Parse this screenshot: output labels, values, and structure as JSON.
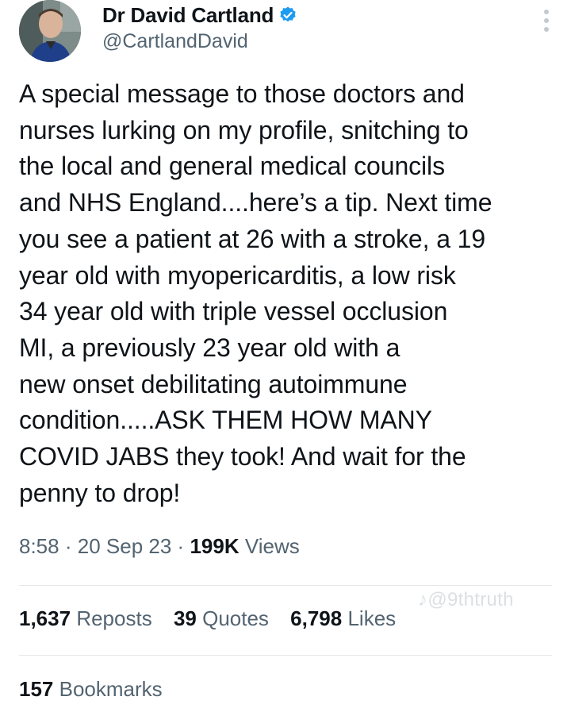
{
  "author": {
    "display_name": "Dr David Cartland",
    "handle": "@CartlandDavid",
    "verified_icon": "verified-badge-icon",
    "avatar_icon": "profile-avatar"
  },
  "tweet": {
    "text": "A special message to those doctors and\nnurses lurking on my profile, snitching to\nthe local and general medical councils\nand NHS England....here’s a tip.  Next time\nyou see a patient at 26 with a stroke, a 19\nyear old with myopericarditis, a low risk\n34 year old with triple vessel occlusion\nMI, a previously 23 year old with a\nnew onset debilitating autoimmune\ncondition.....ASK THEM HOW MANY\nCOVID JABS they took! And wait for the\npenny to drop!",
    "time": "8:58",
    "separator": "·",
    "date": "20 Sep 23",
    "views_count": "199K",
    "views_label": "Views"
  },
  "stats": {
    "reposts_count": "1,637",
    "reposts_label": "Reposts",
    "quotes_count": "39",
    "quotes_label": "Quotes",
    "likes_count": "6,798",
    "likes_label": "Likes",
    "bookmarks_count": "157",
    "bookmarks_label": "Bookmarks"
  },
  "watermark": {
    "text": "@9thtruth",
    "icon": "tiktok-icon"
  },
  "colors": {
    "text_primary": "#0f1419",
    "text_secondary": "#536471",
    "verified_blue": "#1d9bf0",
    "divider": "#e3e7ea"
  }
}
